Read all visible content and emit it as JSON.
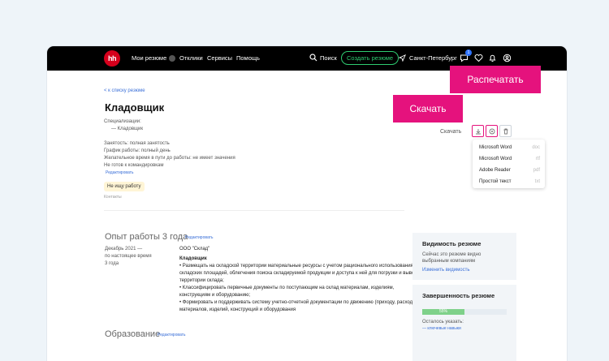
{
  "nav": {
    "logo": "hh",
    "my_resumes": "Мои резюме",
    "responses": "Отклики",
    "services": "Сервисы",
    "help": "Помощь",
    "search": "Поиск",
    "create_resume": "Создать резюме",
    "city": "Санкт-Петербург",
    "notifications_count": "1"
  },
  "resume": {
    "back_link": "< к списку резюме",
    "title": "Кладовщик",
    "specializations_label": "Специализации:",
    "specialization": "— Кладовщик",
    "employment": "Занятость: полная занятость",
    "schedule": "График работы: полный день",
    "travel_time": "Желательное время в пути до работы: не имеет значения",
    "business_trips": "Не готов к командировкам",
    "edit": "Редактировать",
    "status_badge": "Не ищу работу",
    "contacts_partial": "Контакты"
  },
  "experience": {
    "heading": "Опыт работы 3 года",
    "edit": "Редактировать",
    "period_line1": "Декабрь 2021 —",
    "period_line2": "по настоящее время",
    "duration": "3 года",
    "company": "ООО \"Склад\"",
    "position": "Кладовщик",
    "duties": [
      "• Размещать на складской территории материальные ресурсы с учетом рационального использования",
      "складских площадей, облегчения поиска складируемой продукции и доступа к ней для погрузки и вывоза с",
      "территории склада;",
      "• Классифицировать первичные документы по поступающим на склад материалам, изделиям,",
      "конструкциям и оборудованию;",
      "• Формировать и поддерживать систему учетно-отчетной документации по движению (приходу, расходу)",
      "материалов, изделий, конструкций и оборудования"
    ]
  },
  "education": {
    "heading": "Образование",
    "edit": "Редактировать"
  },
  "visibility": {
    "title": "Видимость резюме",
    "line1": "Сейчас это резюме видно",
    "line2": "выбранным компаниям",
    "link": "Изменить видимость"
  },
  "completeness": {
    "title": "Завершенность резюме",
    "percent_label": "55%",
    "percent": 0.5,
    "remaining": "Осталось указать:",
    "item": "— ключевые навыки"
  },
  "download_menu": {
    "items": [
      {
        "label": "Microsoft Word",
        "format": "doc"
      },
      {
        "label": "Microsoft Word",
        "format": "rtf"
      },
      {
        "label": "Adobe Reader",
        "format": "pdf"
      },
      {
        "label": "Простой текст",
        "format": "txt"
      }
    ],
    "hidden_label": "Скачать"
  },
  "callouts": {
    "print": "Распечатать",
    "download": "Скачать"
  },
  "colors": {
    "accent": "#e5127d",
    "logo": "#d6001c",
    "link": "#3a6fd8",
    "cta": "#2ecc71"
  }
}
